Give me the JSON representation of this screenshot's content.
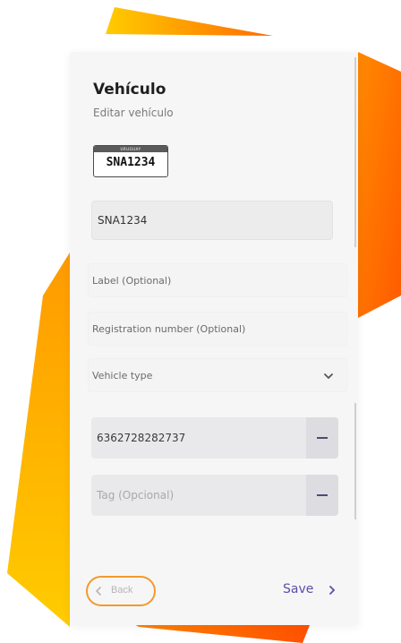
{
  "header": {
    "title": "Vehículo",
    "subtitle": "Editar vehículo"
  },
  "plate": {
    "country": "URUGUAY",
    "number": "SNA1234"
  },
  "fields": {
    "plate_input_value": "SNA1234",
    "label_placeholder": "Label (Optional)",
    "registration_placeholder": "Registration number (Optional)",
    "vehicle_type_placeholder": "Vehicle type"
  },
  "tags": [
    {
      "value": "6362728282737"
    },
    {
      "placeholder": "Tag (Opcional)"
    }
  ],
  "footer": {
    "back_label": "Back",
    "save_label": "Save"
  },
  "icons": {
    "vehicle_type": "chevron-down-icon",
    "remove_tag": "minus-icon",
    "back": "chevron-left-icon",
    "save": "chevron-right-icon"
  },
  "colors": {
    "accent": "#5b4fa8",
    "highlight_ring": "#f39a2c",
    "decor_orange": "#ff6a00",
    "decor_yellow": "#ffcc00"
  }
}
